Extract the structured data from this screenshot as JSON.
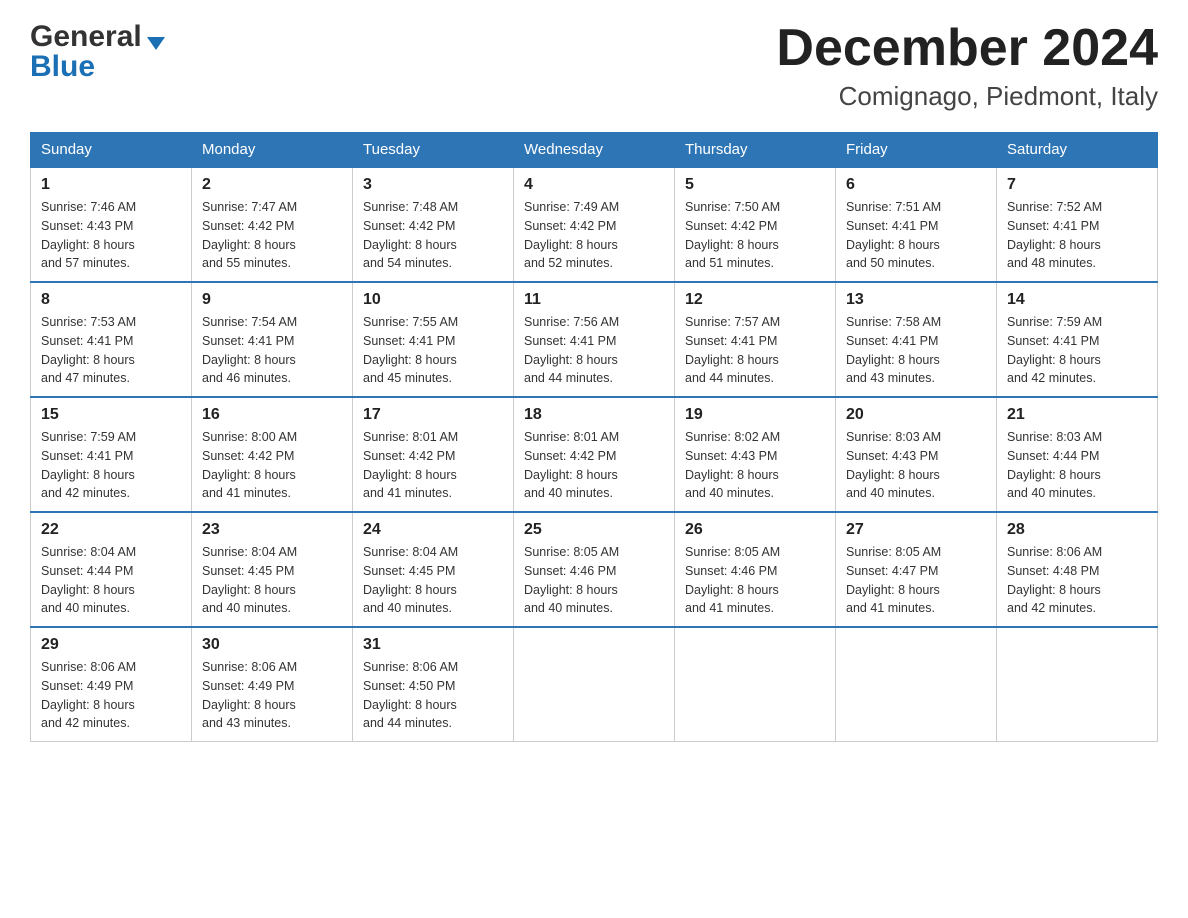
{
  "header": {
    "logo_general": "General",
    "logo_blue": "Blue",
    "month_title": "December 2024",
    "location": "Comignago, Piedmont, Italy"
  },
  "days_of_week": [
    "Sunday",
    "Monday",
    "Tuesday",
    "Wednesday",
    "Thursday",
    "Friday",
    "Saturday"
  ],
  "weeks": [
    [
      {
        "day": "1",
        "sunrise": "7:46 AM",
        "sunset": "4:43 PM",
        "daylight_h": "8 hours",
        "daylight_m": "and 57 minutes."
      },
      {
        "day": "2",
        "sunrise": "7:47 AM",
        "sunset": "4:42 PM",
        "daylight_h": "8 hours",
        "daylight_m": "and 55 minutes."
      },
      {
        "day": "3",
        "sunrise": "7:48 AM",
        "sunset": "4:42 PM",
        "daylight_h": "8 hours",
        "daylight_m": "and 54 minutes."
      },
      {
        "day": "4",
        "sunrise": "7:49 AM",
        "sunset": "4:42 PM",
        "daylight_h": "8 hours",
        "daylight_m": "and 52 minutes."
      },
      {
        "day": "5",
        "sunrise": "7:50 AM",
        "sunset": "4:42 PM",
        "daylight_h": "8 hours",
        "daylight_m": "and 51 minutes."
      },
      {
        "day": "6",
        "sunrise": "7:51 AM",
        "sunset": "4:41 PM",
        "daylight_h": "8 hours",
        "daylight_m": "and 50 minutes."
      },
      {
        "day": "7",
        "sunrise": "7:52 AM",
        "sunset": "4:41 PM",
        "daylight_h": "8 hours",
        "daylight_m": "and 48 minutes."
      }
    ],
    [
      {
        "day": "8",
        "sunrise": "7:53 AM",
        "sunset": "4:41 PM",
        "daylight_h": "8 hours",
        "daylight_m": "and 47 minutes."
      },
      {
        "day": "9",
        "sunrise": "7:54 AM",
        "sunset": "4:41 PM",
        "daylight_h": "8 hours",
        "daylight_m": "and 46 minutes."
      },
      {
        "day": "10",
        "sunrise": "7:55 AM",
        "sunset": "4:41 PM",
        "daylight_h": "8 hours",
        "daylight_m": "and 45 minutes."
      },
      {
        "day": "11",
        "sunrise": "7:56 AM",
        "sunset": "4:41 PM",
        "daylight_h": "8 hours",
        "daylight_m": "and 44 minutes."
      },
      {
        "day": "12",
        "sunrise": "7:57 AM",
        "sunset": "4:41 PM",
        "daylight_h": "8 hours",
        "daylight_m": "and 44 minutes."
      },
      {
        "day": "13",
        "sunrise": "7:58 AM",
        "sunset": "4:41 PM",
        "daylight_h": "8 hours",
        "daylight_m": "and 43 minutes."
      },
      {
        "day": "14",
        "sunrise": "7:59 AM",
        "sunset": "4:41 PM",
        "daylight_h": "8 hours",
        "daylight_m": "and 42 minutes."
      }
    ],
    [
      {
        "day": "15",
        "sunrise": "7:59 AM",
        "sunset": "4:41 PM",
        "daylight_h": "8 hours",
        "daylight_m": "and 42 minutes."
      },
      {
        "day": "16",
        "sunrise": "8:00 AM",
        "sunset": "4:42 PM",
        "daylight_h": "8 hours",
        "daylight_m": "and 41 minutes."
      },
      {
        "day": "17",
        "sunrise": "8:01 AM",
        "sunset": "4:42 PM",
        "daylight_h": "8 hours",
        "daylight_m": "and 41 minutes."
      },
      {
        "day": "18",
        "sunrise": "8:01 AM",
        "sunset": "4:42 PM",
        "daylight_h": "8 hours",
        "daylight_m": "and 40 minutes."
      },
      {
        "day": "19",
        "sunrise": "8:02 AM",
        "sunset": "4:43 PM",
        "daylight_h": "8 hours",
        "daylight_m": "and 40 minutes."
      },
      {
        "day": "20",
        "sunrise": "8:03 AM",
        "sunset": "4:43 PM",
        "daylight_h": "8 hours",
        "daylight_m": "and 40 minutes."
      },
      {
        "day": "21",
        "sunrise": "8:03 AM",
        "sunset": "4:44 PM",
        "daylight_h": "8 hours",
        "daylight_m": "and 40 minutes."
      }
    ],
    [
      {
        "day": "22",
        "sunrise": "8:04 AM",
        "sunset": "4:44 PM",
        "daylight_h": "8 hours",
        "daylight_m": "and 40 minutes."
      },
      {
        "day": "23",
        "sunrise": "8:04 AM",
        "sunset": "4:45 PM",
        "daylight_h": "8 hours",
        "daylight_m": "and 40 minutes."
      },
      {
        "day": "24",
        "sunrise": "8:04 AM",
        "sunset": "4:45 PM",
        "daylight_h": "8 hours",
        "daylight_m": "and 40 minutes."
      },
      {
        "day": "25",
        "sunrise": "8:05 AM",
        "sunset": "4:46 PM",
        "daylight_h": "8 hours",
        "daylight_m": "and 40 minutes."
      },
      {
        "day": "26",
        "sunrise": "8:05 AM",
        "sunset": "4:46 PM",
        "daylight_h": "8 hours",
        "daylight_m": "and 41 minutes."
      },
      {
        "day": "27",
        "sunrise": "8:05 AM",
        "sunset": "4:47 PM",
        "daylight_h": "8 hours",
        "daylight_m": "and 41 minutes."
      },
      {
        "day": "28",
        "sunrise": "8:06 AM",
        "sunset": "4:48 PM",
        "daylight_h": "8 hours",
        "daylight_m": "and 42 minutes."
      }
    ],
    [
      {
        "day": "29",
        "sunrise": "8:06 AM",
        "sunset": "4:49 PM",
        "daylight_h": "8 hours",
        "daylight_m": "and 42 minutes."
      },
      {
        "day": "30",
        "sunrise": "8:06 AM",
        "sunset": "4:49 PM",
        "daylight_h": "8 hours",
        "daylight_m": "and 43 minutes."
      },
      {
        "day": "31",
        "sunrise": "8:06 AM",
        "sunset": "4:50 PM",
        "daylight_h": "8 hours",
        "daylight_m": "and 44 minutes."
      },
      null,
      null,
      null,
      null
    ]
  ],
  "labels": {
    "sunrise_prefix": "Sunrise: ",
    "sunset_prefix": "Sunset: ",
    "daylight_prefix": "Daylight: "
  }
}
